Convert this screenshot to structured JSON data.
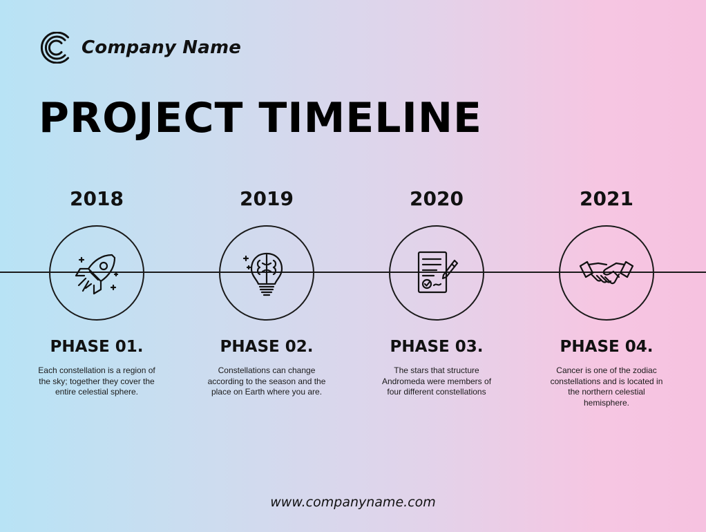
{
  "company": {
    "name": "Company Name",
    "logo_icon": "c-circle-logo-icon"
  },
  "title": "PROJECT TIMELINE",
  "phases": [
    {
      "year": "2018",
      "label": "PHASE 01.",
      "icon": "rocket-icon",
      "description": "Each constellation is a region of the sky; together they cover the entire celestial sphere."
    },
    {
      "year": "2019",
      "label": "PHASE 02.",
      "icon": "brain-lightbulb-icon",
      "description": "Constellations can change according to the season and the place on Earth where you are."
    },
    {
      "year": "2020",
      "label": "PHASE 03.",
      "icon": "signed-document-icon",
      "description": "The stars that structure Andromeda were members of four different constellations"
    },
    {
      "year": "2021",
      "label": "PHASE 04.",
      "icon": "handshake-icon",
      "description": "Cancer is one of the zodiac constellations and is located in the northern celestial hemisphere."
    }
  ],
  "website": "www.companyname.com",
  "colors": {
    "gradient_left": "#b8e3f5",
    "gradient_right": "#f6c2e0",
    "ink": "#111111"
  }
}
